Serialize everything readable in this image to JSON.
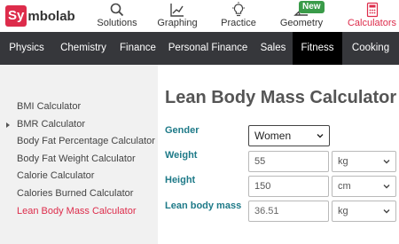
{
  "header": {
    "logo_highlight": "Sy",
    "logo_rest": "mbolab",
    "nav": [
      {
        "label": "Solutions",
        "icon": "search-icon"
      },
      {
        "label": "Graphing",
        "icon": "graph-icon"
      },
      {
        "label": "Practice",
        "icon": "lightbulb-icon"
      },
      {
        "label": "Geometry",
        "icon": "angle-icon",
        "badge": "New"
      },
      {
        "label": "Calculators",
        "icon": "calculator-icon"
      }
    ],
    "accent_color": "#dd2c4b",
    "badge_color": "#3a9b49"
  },
  "categories": [
    {
      "label": "Physics"
    },
    {
      "label": "Chemistry"
    },
    {
      "label": "Finance"
    },
    {
      "label": "Personal Finance"
    },
    {
      "label": "Sales"
    },
    {
      "label": "Fitness",
      "active": true
    },
    {
      "label": "Cooking"
    }
  ],
  "sidebar": {
    "items": [
      {
        "label": "BMI Calculator"
      },
      {
        "label": "BMR Calculator"
      },
      {
        "label": "Body Fat Percentage Calculator"
      },
      {
        "label": "Body Fat Weight Calculator"
      },
      {
        "label": "Calorie Calculator"
      },
      {
        "label": "Calories Burned Calculator"
      },
      {
        "label": "Lean Body Mass Calculator",
        "active": true
      }
    ]
  },
  "main": {
    "title": "Lean Body Mass Calculator",
    "gender": {
      "label": "Gender",
      "value": "Women"
    },
    "weight": {
      "label": "Weight",
      "value": "55",
      "unit": "kg"
    },
    "height": {
      "label": "Height",
      "value": "150",
      "unit": "cm"
    },
    "result": {
      "label": "Lean body mass",
      "value": "36.51",
      "unit": "kg"
    }
  }
}
